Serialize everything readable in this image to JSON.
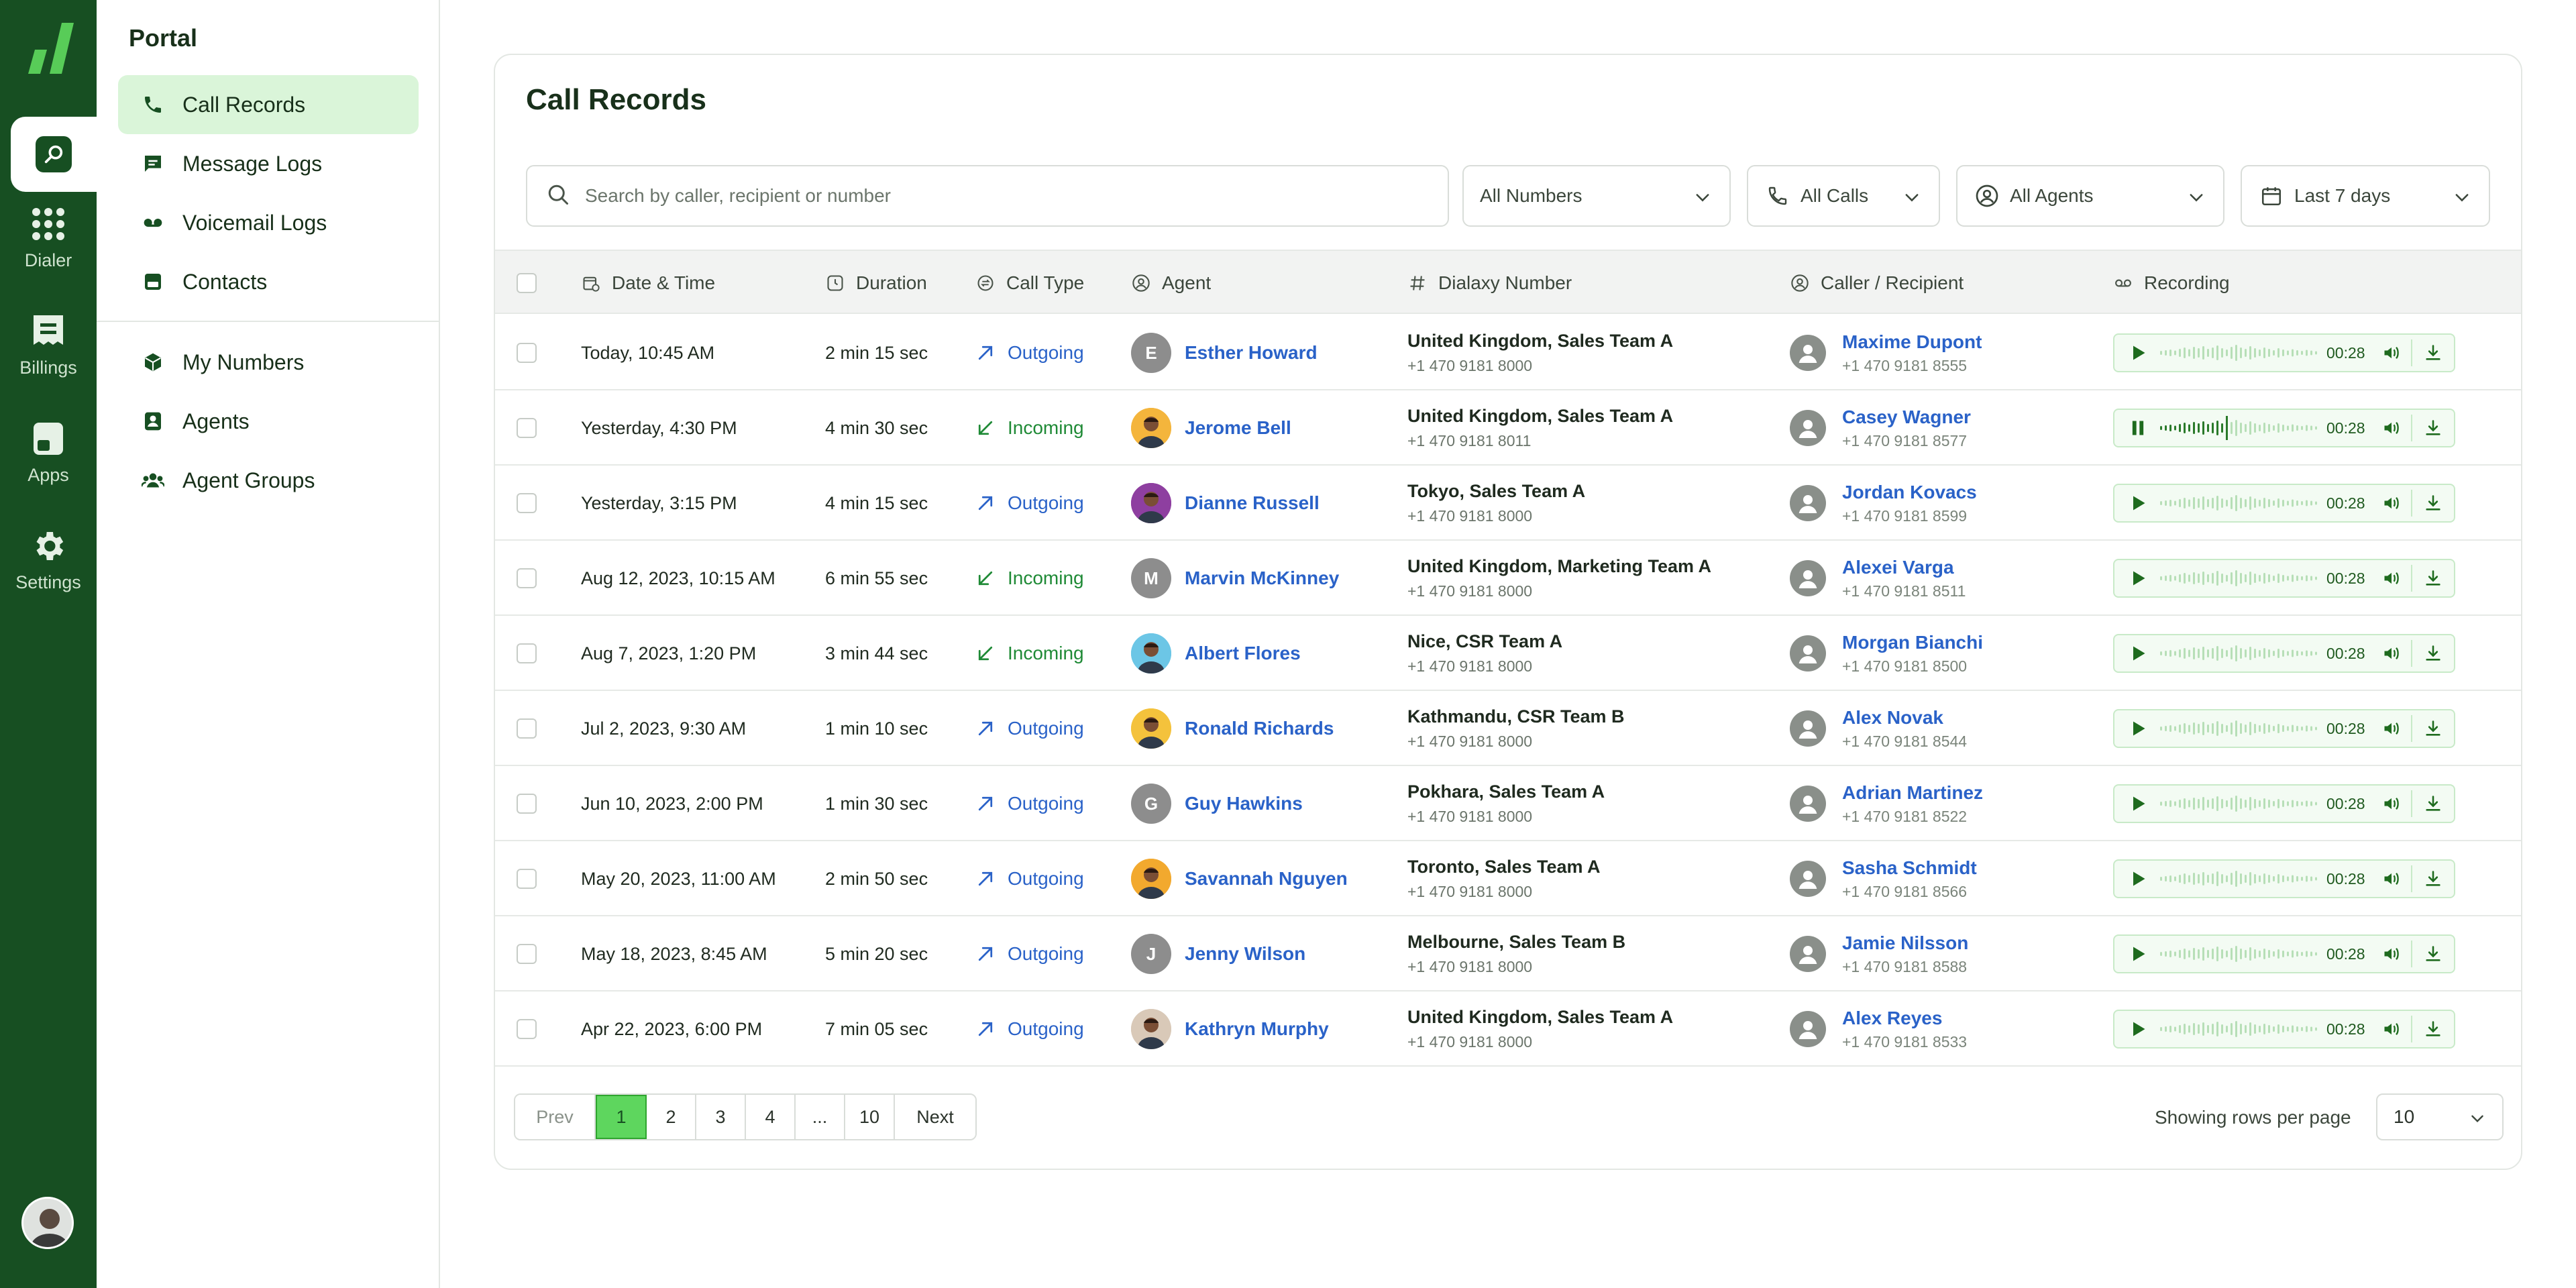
{
  "rail": {
    "items": [
      {
        "label": "Dialer",
        "icon": "dialpad-icon"
      },
      {
        "label": "Billings",
        "icon": "billing-icon"
      },
      {
        "label": "Apps",
        "icon": "apps-icon"
      },
      {
        "label": "Settings",
        "icon": "gear-icon"
      }
    ],
    "active_icon": "portal-icon"
  },
  "sidebar": {
    "title": "Portal",
    "items": [
      {
        "label": "Call Records",
        "icon": "phone-icon",
        "active": true
      },
      {
        "label": "Message Logs",
        "icon": "message-icon"
      },
      {
        "label": "Voicemail Logs",
        "icon": "voicemail-icon"
      },
      {
        "label": "Contacts",
        "icon": "contacts-icon"
      },
      {
        "label": "My Numbers",
        "icon": "cube-icon"
      },
      {
        "label": "Agents",
        "icon": "agent-icon"
      },
      {
        "label": "Agent Groups",
        "icon": "group-icon"
      }
    ]
  },
  "page": {
    "title": "Call Records",
    "search_placeholder": "Search by caller, recipient or number",
    "filters": {
      "numbers": "All Numbers",
      "calls": "All Calls",
      "agents": "All Agents",
      "range": "Last 7 days"
    }
  },
  "table": {
    "columns": {
      "datetime": "Date & Time",
      "duration": "Duration",
      "calltype": "Call Type",
      "agent": "Agent",
      "number": "Dialaxy Number",
      "caller": "Caller / Recipient",
      "recording": "Recording"
    },
    "rows": [
      {
        "date": "Today, 10:45 AM",
        "duration": "2 min 15 sec",
        "type": "Outgoing",
        "agent": "Esther Howard",
        "initial": "E",
        "avatar": "#8d8d8d",
        "team": "United Kingdom, Sales Team A",
        "team_number": "+1 470 9181 8000",
        "caller": "Maxime Dupont",
        "caller_number": "+1 470 9181 8555",
        "rec_time": "00:28",
        "playing": false
      },
      {
        "date": "Yesterday, 4:30 PM",
        "duration": "4 min 30 sec",
        "type": "Incoming",
        "agent": "Jerome Bell",
        "initial": "",
        "avatar": "#f4b53c",
        "team": "United Kingdom, Sales Team A",
        "team_number": "+1 470 9181 8011",
        "caller": "Casey Wagner",
        "caller_number": "+1 470 9181 8577",
        "rec_time": "00:28",
        "playing": true
      },
      {
        "date": "Yesterday, 3:15 PM",
        "duration": "4 min 15 sec",
        "type": "Outgoing",
        "agent": "Dianne Russell",
        "initial": "",
        "avatar": "#8e3fa0",
        "team": "Tokyo, Sales Team A",
        "team_number": "+1 470 9181 8000",
        "caller": "Jordan Kovacs",
        "caller_number": "+1 470 9181 8599",
        "rec_time": "00:28",
        "playing": false
      },
      {
        "date": "Aug 12, 2023, 10:15 AM",
        "duration": "6 min 55 sec",
        "type": "Incoming",
        "agent": "Marvin McKinney",
        "initial": "M",
        "avatar": "#8d8d8d",
        "team": "United Kingdom, Marketing Team A",
        "team_number": "+1 470 9181 8000",
        "caller": "Alexei Varga",
        "caller_number": "+1 470 9181 8511",
        "rec_time": "00:28",
        "playing": false
      },
      {
        "date": "Aug 7, 2023, 1:20 PM",
        "duration": "3 min 44 sec",
        "type": "Incoming",
        "agent": "Albert Flores",
        "initial": "",
        "avatar": "#6cc6e6",
        "team": "Nice, CSR Team A",
        "team_number": "+1 470 9181 8000",
        "caller": "Morgan Bianchi",
        "caller_number": "+1 470 9181 8500",
        "rec_time": "00:28",
        "playing": false
      },
      {
        "date": "Jul 2, 2023, 9:30 AM",
        "duration": "1 min 10 sec",
        "type": "Outgoing",
        "agent": "Ronald Richards",
        "initial": "",
        "avatar": "#f4c23c",
        "team": "Kathmandu, CSR Team B",
        "team_number": "+1 470 9181 8000",
        "caller": "Alex Novak",
        "caller_number": "+1 470 9181 8544",
        "rec_time": "00:28",
        "playing": false
      },
      {
        "date": "Jun 10, 2023, 2:00 PM",
        "duration": "1 min 30 sec",
        "type": "Outgoing",
        "agent": "Guy Hawkins",
        "initial": "G",
        "avatar": "#8d8d8d",
        "team": "Pokhara, Sales Team A",
        "team_number": "+1 470 9181 8000",
        "caller": "Adrian Martinez",
        "caller_number": "+1 470 9181 8522",
        "rec_time": "00:28",
        "playing": false
      },
      {
        "date": "May 20, 2023, 11:00 AM",
        "duration": "2 min 50 sec",
        "type": "Outgoing",
        "agent": "Savannah Nguyen",
        "initial": "",
        "avatar": "#f2a92e",
        "team": "Toronto, Sales Team A",
        "team_number": "+1 470 9181 8000",
        "caller": "Sasha Schmidt",
        "caller_number": "+1 470 9181 8566",
        "rec_time": "00:28",
        "playing": false
      },
      {
        "date": "May 18, 2023, 8:45 AM",
        "duration": "5 min 20 sec",
        "type": "Outgoing",
        "agent": "Jenny Wilson",
        "initial": "J",
        "avatar": "#8d8d8d",
        "team": "Melbourne, Sales Team B",
        "team_number": "+1 470 9181 8000",
        "caller": "Jamie Nilsson",
        "caller_number": "+1 470 9181 8588",
        "rec_time": "00:28",
        "playing": false
      },
      {
        "date": "Apr 22, 2023, 6:00 PM",
        "duration": "7 min 05 sec",
        "type": "Outgoing",
        "agent": "Kathryn Murphy",
        "initial": "",
        "avatar": "#d9c9b8",
        "team": "United Kingdom, Sales Team A",
        "team_number": "+1 470 9181 8000",
        "caller": "Alex Reyes",
        "caller_number": "+1 470 9181 8533",
        "rec_time": "00:28",
        "playing": false
      }
    ]
  },
  "pagination": {
    "prev": "Prev",
    "pages": [
      "1",
      "2",
      "3",
      "4",
      "...",
      "10"
    ],
    "active": "1",
    "next": "Next",
    "rows_label": "Showing rows per page",
    "rows_value": "10"
  },
  "colors": {
    "rail": "#174f22",
    "accent": "#5ed65e",
    "active_bg": "#daf5d9",
    "link": "#2a62c8",
    "incoming": "#1f8a36"
  }
}
